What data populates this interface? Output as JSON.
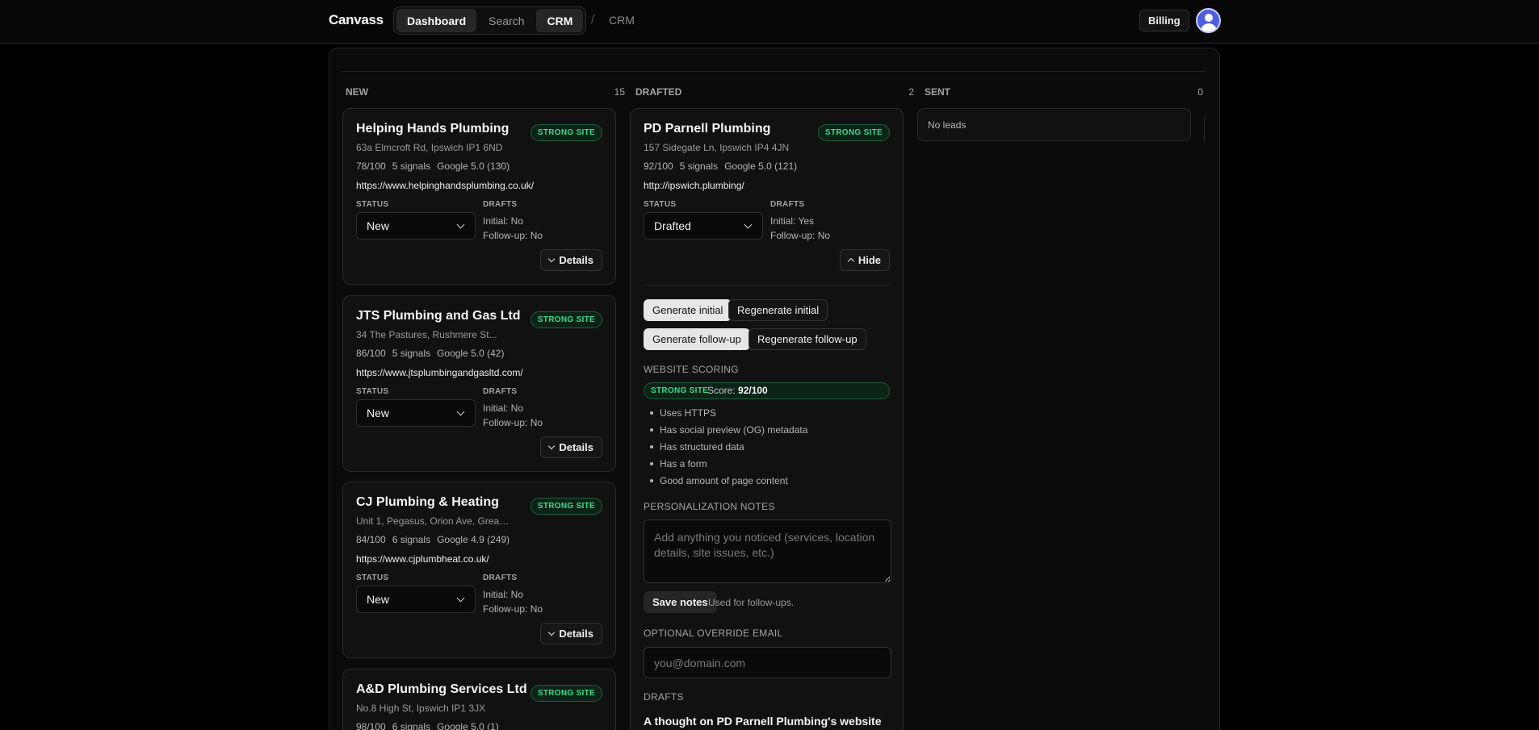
{
  "app": {
    "brand": "Canvass"
  },
  "nav": {
    "tabs": [
      {
        "label": "Dashboard",
        "active": true
      },
      {
        "label": "Search",
        "active": false
      },
      {
        "label": "CRM",
        "active": true
      }
    ],
    "separator": "/",
    "breadcrumb": "CRM",
    "billing_label": "Billing",
    "avatar_color": "#4f5fe0"
  },
  "columns": [
    {
      "title": "NEW",
      "count": "15"
    },
    {
      "title": "DRAFTED",
      "count": "2"
    },
    {
      "title": "SENT",
      "count": "0",
      "empty_label": "No leads"
    }
  ],
  "labels": {
    "status": "STATUS",
    "drafts": "DRAFTS",
    "details": "Details",
    "hide": "Hide"
  },
  "new_leads": [
    {
      "name": "Helping Hands Plumbing",
      "badge": "STRONG SITE",
      "address": "63a Elmcroft Rd, Ipswich IP1 6ND",
      "score": "78/100",
      "signals": "5 signals",
      "google": "Google 5.0 (130)",
      "url": "https://www.helpinghandsplumbing.co.uk/",
      "status": "New",
      "initial": "Initial: No",
      "followup": "Follow-up: No"
    },
    {
      "name": "JTS Plumbing and Gas Ltd",
      "badge": "STRONG SITE",
      "address": "34 The Pastures, Rushmere St...",
      "score": "86/100",
      "signals": "5 signals",
      "google": "Google 5.0 (42)",
      "url": "https://www.jtsplumbingandgasltd.com/",
      "status": "New",
      "initial": "Initial: No",
      "followup": "Follow-up: No"
    },
    {
      "name": "CJ Plumbing & Heating",
      "badge": "STRONG SITE",
      "address": "Unit 1, Pegasus, Orion Ave, Great...",
      "score": "84/100",
      "signals": "6 signals",
      "google": "Google 4.9 (249)",
      "url": "https://www.cjplumbheat.co.uk/",
      "status": "New",
      "initial": "Initial: No",
      "followup": "Follow-up: No"
    },
    {
      "name": "A&D Plumbing Services Ltd",
      "badge": "STRONG SITE",
      "address": "No.8 High St, Ipswich IP1 3JX",
      "score": "98/100",
      "signals": "6 signals",
      "google": "Google 5.0 (1)"
    }
  ],
  "drafted_lead": {
    "name": "PD Parnell Plumbing",
    "badge": "STRONG SITE",
    "address": "157 Sidegate Ln, Ipswich IP4 4JN",
    "score": "92/100",
    "signals": "5 signals",
    "google": "Google 5.0 (121)",
    "url": "http://ipswich.plumbing/",
    "status": "Drafted",
    "initial": "Initial: Yes",
    "followup": "Follow-up: No",
    "actions": {
      "generate_initial": "Generate initial",
      "regenerate_initial": "Regenerate initial",
      "generate_followup": "Generate follow-up",
      "regenerate_followup": "Regenerate follow-up"
    },
    "website_scoring_label": "WEBSITE SCORING",
    "score_prefix": "Score:",
    "score_value": "92/100",
    "signal_list": [
      "Uses HTTPS",
      "Has social preview (OG) metadata",
      "Has structured data",
      "Has a form",
      "Good amount of page content"
    ],
    "notes_label": "PERSONALIZATION NOTES",
    "notes_placeholder": "Add anything you noticed (services, location details, site issues, etc.)",
    "save_notes": "Save notes",
    "notes_hint": "Used for follow-ups.",
    "override_label": "OPTIONAL OVERRIDE EMAIL",
    "email_placeholder": "you@domain.com",
    "drafts_label": "DRAFTS",
    "draft_subject": "A thought on PD Parnell Plumbing's website"
  },
  "colors": {
    "accent_green": "#3fd889",
    "background": "#000000",
    "card": "#111111"
  }
}
